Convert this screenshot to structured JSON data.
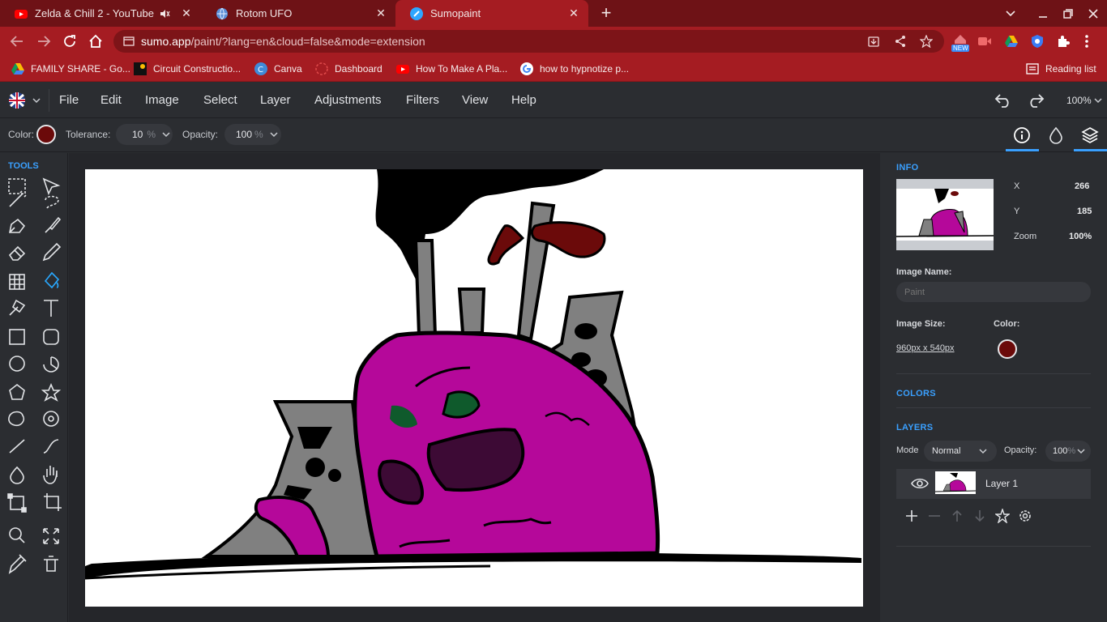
{
  "browser": {
    "tabs": [
      {
        "title": "Zelda & Chill 2 - YouTube",
        "icon": "youtube-icon",
        "muted_icon": "speaker-icon"
      },
      {
        "title": "Rotom UFO",
        "icon": "globe-icon"
      },
      {
        "title": "Sumopaint",
        "icon": "sumopaint-icon",
        "active": true
      }
    ],
    "new_tab": "+",
    "url_host": "sumo.app",
    "url_path": "/paint/?lang=en&cloud=false&mode=extension",
    "extension_badge": "NEW",
    "bookmarks": [
      {
        "label": "FAMILY SHARE - Go...",
        "icon": "drive-icon"
      },
      {
        "label": "Circuit Constructio...",
        "icon": "phet-icon"
      },
      {
        "label": "Canva",
        "icon": "canva-icon"
      },
      {
        "label": "Dashboard",
        "icon": "dashboard-icon"
      },
      {
        "label": "How To Make A Pla...",
        "icon": "youtube-icon"
      },
      {
        "label": "how to hypnotize p...",
        "icon": "google-icon"
      }
    ],
    "reading_list": "Reading list",
    "colors": {
      "frame": "#6e1216",
      "toolbar": "#a51c22"
    }
  },
  "app": {
    "menu": [
      "File",
      "Edit",
      "Image",
      "Select",
      "Layer",
      "Adjustments",
      "Filters",
      "View",
      "Help"
    ],
    "zoom": "100%",
    "options": {
      "color_label": "Color:",
      "color": "#6b0a0a",
      "tolerance_label": "Tolerance:",
      "tolerance_value": "10",
      "tolerance_unit": "%",
      "opacity_label": "Opacity:",
      "opacity_value": "100",
      "opacity_unit": "%"
    },
    "tools_title": "TOOLS",
    "info": {
      "title": "INFO",
      "x_label": "X",
      "x_value": "266",
      "y_label": "Y",
      "y_value": "185",
      "zoom_label": "Zoom",
      "zoom_value": "100%",
      "image_name_label": "Image Name:",
      "image_name_placeholder": "Paint",
      "image_size_label": "Image Size:",
      "image_size_value": "960px x 540px",
      "color_label": "Color:",
      "color": "#6b0a0a"
    },
    "colors_title": "COLORS",
    "layers": {
      "title": "LAYERS",
      "mode_label": "Mode",
      "mode_value": "Normal",
      "opacity_label": "Opacity:",
      "opacity_value": "100",
      "opacity_unit": "%",
      "items": [
        {
          "name": "Layer 1",
          "visible": true
        }
      ]
    },
    "accent": "#3aa0ff"
  }
}
